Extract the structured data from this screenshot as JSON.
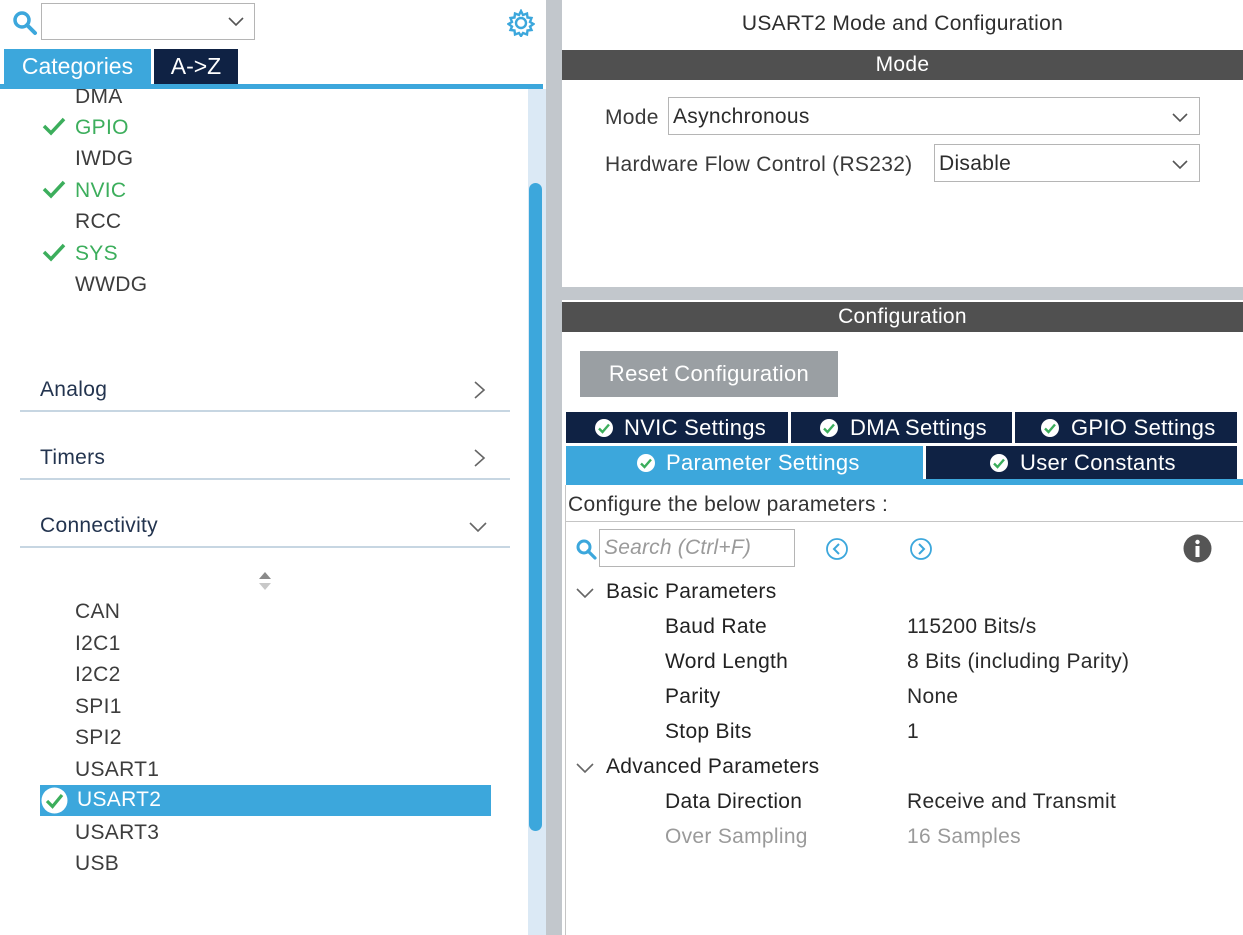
{
  "left": {
    "search": {
      "value": ""
    },
    "tabs": [
      {
        "label": "Categories",
        "active": true
      },
      {
        "label": "A->Z",
        "active": false
      }
    ],
    "system_items": [
      {
        "label": "DMA",
        "configured": false
      },
      {
        "label": "GPIO",
        "configured": true
      },
      {
        "label": "IWDG",
        "configured": false
      },
      {
        "label": "NVIC",
        "configured": true
      },
      {
        "label": "RCC",
        "configured": false
      },
      {
        "label": "SYS",
        "configured": true
      },
      {
        "label": "WWDG",
        "configured": false
      }
    ],
    "groups": [
      {
        "label": "Analog",
        "expanded": false
      },
      {
        "label": "Timers",
        "expanded": false
      },
      {
        "label": "Connectivity",
        "expanded": true
      }
    ],
    "connectivity_items": [
      {
        "label": "CAN"
      },
      {
        "label": "I2C1"
      },
      {
        "label": "I2C2"
      },
      {
        "label": "SPI1"
      },
      {
        "label": "SPI2"
      },
      {
        "label": "USART1"
      },
      {
        "label": "USART2",
        "selected": true,
        "configured": true
      },
      {
        "label": "USART3"
      },
      {
        "label": "USB"
      }
    ]
  },
  "right": {
    "title": "USART2 Mode and Configuration",
    "mode_bar": "Mode",
    "mode_field": {
      "label": "Mode",
      "value": "Asynchronous"
    },
    "flow_field": {
      "label": "Hardware Flow Control (RS232)",
      "value": "Disable"
    },
    "config_bar": "Configuration",
    "reset_button": "Reset Configuration",
    "tabs": [
      {
        "label": "NVIC Settings",
        "active": false
      },
      {
        "label": "DMA Settings",
        "active": false
      },
      {
        "label": "GPIO Settings",
        "active": false
      },
      {
        "label": "Parameter Settings",
        "active": true
      },
      {
        "label": "User Constants",
        "active": false
      }
    ],
    "configure_text": "Configure the below parameters :",
    "search_placeholder": "Search (Ctrl+F)",
    "sections": [
      {
        "label": "Basic Parameters",
        "params": [
          {
            "name": "Baud Rate",
            "value": "115200 Bits/s"
          },
          {
            "name": "Word Length",
            "value": "8 Bits (including Parity)"
          },
          {
            "name": "Parity",
            "value": "None"
          },
          {
            "name": "Stop Bits",
            "value": "1"
          }
        ]
      },
      {
        "label": "Advanced Parameters",
        "params": [
          {
            "name": "Data Direction",
            "value": "Receive and Transmit",
            "enabled": true
          },
          {
            "name": "Over Sampling",
            "value": "16 Samples",
            "enabled": false
          }
        ]
      }
    ]
  },
  "colors": {
    "accent": "#3ca7dc",
    "navy": "#0f2244",
    "ok_green": "#3cae5c",
    "bar_gray": "#505050"
  }
}
